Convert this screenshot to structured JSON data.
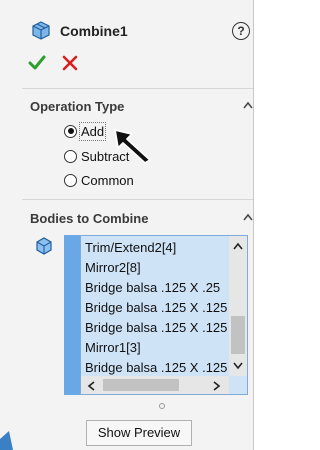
{
  "header": {
    "title": "Combine1",
    "help_glyph": "?",
    "ok_icon": "green-checkmark-icon",
    "cancel_icon": "red-x-icon"
  },
  "operation_type": {
    "title": "Operation Type",
    "options": [
      {
        "label": "Add",
        "selected": true
      },
      {
        "label": "Subtract",
        "selected": false
      },
      {
        "label": "Common",
        "selected": false
      }
    ]
  },
  "bodies": {
    "title": "Bodies to Combine",
    "items": [
      "Trim/Extend2[4]",
      "Mirror2[8]",
      "Bridge balsa .125 X .25",
      "Bridge balsa .125 X .125",
      "Bridge balsa .125 X .125",
      "Mirror1[3]",
      "Bridge balsa .125 X .125"
    ]
  },
  "actions": {
    "show_preview_label": "Show Preview"
  },
  "colors": {
    "accent_blue": "#6aa7e6",
    "list_bg": "#cfe3f7",
    "ok_green": "#2e9e2e",
    "cancel_red": "#d62020"
  }
}
